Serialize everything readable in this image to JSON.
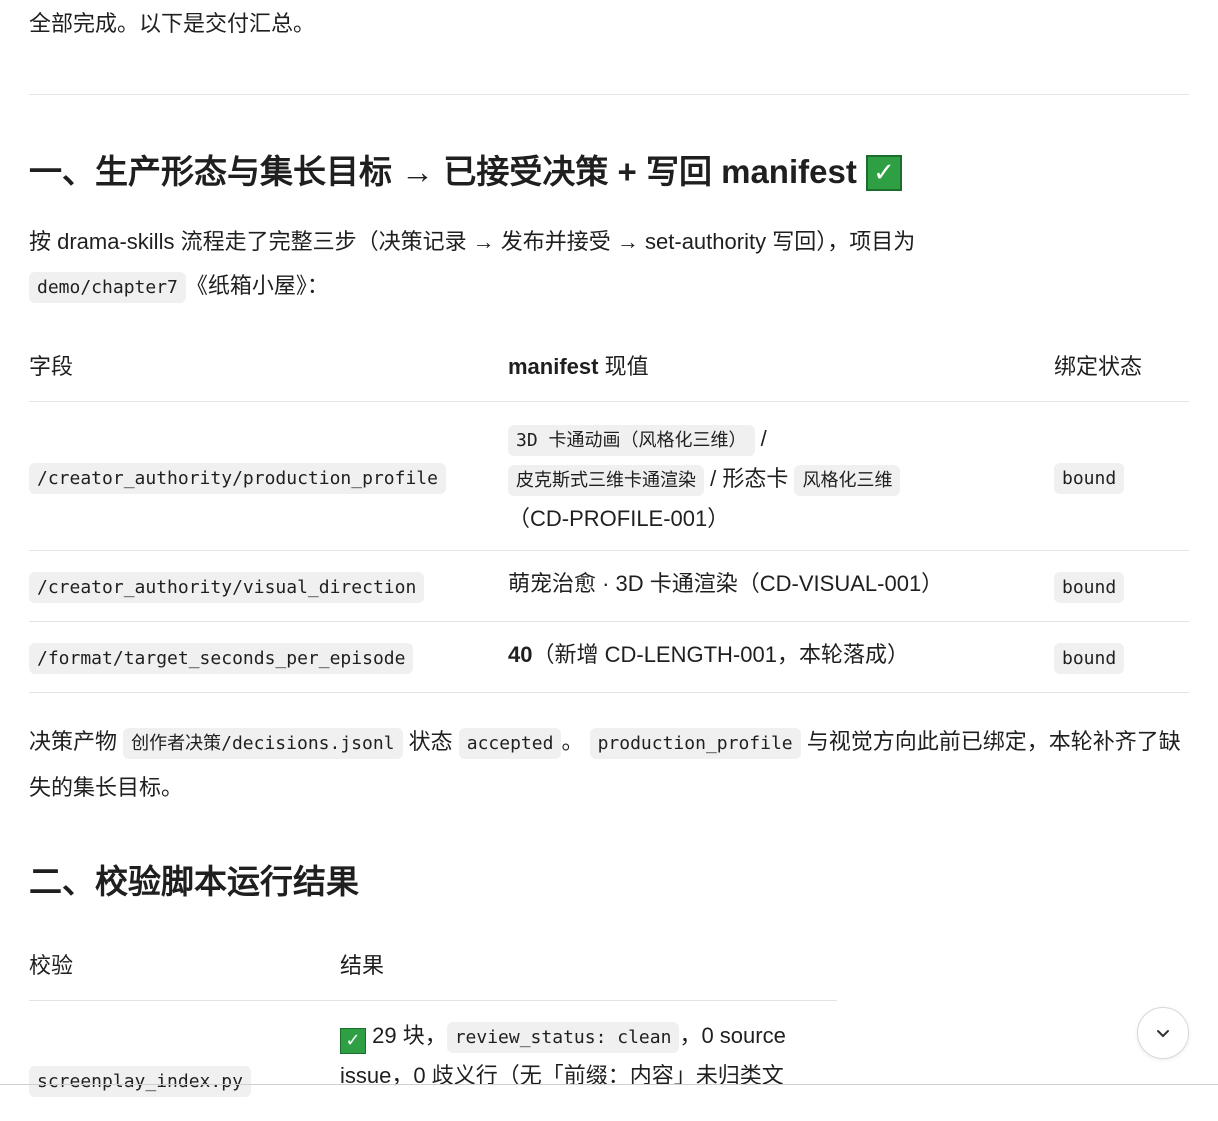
{
  "intro": "全部完成。以下是交付汇总。",
  "section1": {
    "title": "一、生产形态与集长目标 → 已接受决策 + 写回 manifest",
    "para_a": "按 drama-skills 流程走了完整三步（决策记录 → 发布并接受 → set-authority 写回），项目为",
    "para_code": "demo/chapter7",
    "para_b": "《纸箱小屋》：",
    "table": {
      "headers": [
        "字段",
        "manifest 现值",
        "绑定状态"
      ],
      "rows": [
        {
          "field": "/creator_authority/production_profile",
          "v_code1": "3D 卡通动画（风格化三维）",
          "v_sep1": " /",
          "v_code2": "皮克斯式三维卡通渲染",
          "v_mid": " / 形态卡 ",
          "v_code3": "风格化三维",
          "v_tail": "（CD-PROFILE-001）",
          "status": "bound"
        },
        {
          "field": "/creator_authority/visual_direction",
          "value": "萌宠治愈 · 3D 卡通渲染（CD-VISUAL-001）",
          "status": "bound"
        },
        {
          "field": "/format/target_seconds_per_episode",
          "value_bold": "40",
          "value": "（新增 CD-LENGTH-001，本轮落成）",
          "status": "bound"
        }
      ]
    },
    "note": {
      "t1": "决策产物 ",
      "c1": "创作者决策/decisions.jsonl",
      "t2": " 状态 ",
      "c2": "accepted",
      "t3": "。 ",
      "c3": "production_profile",
      "t4": " 与视觉方向此前已绑定，本轮补齐了缺失的集长目标。"
    }
  },
  "section2": {
    "title": "二、校验脚本运行结果",
    "table": {
      "headers": [
        "校验",
        "结果"
      ],
      "rows": [
        {
          "check": "screenplay_index.py",
          "r1": " 29 块，",
          "rc": "review_status: clean",
          "r2": "，0 source",
          "r3": "issue，0 歧义行（无「前缀：内容」未归类文"
        }
      ]
    }
  },
  "icons": {
    "check": "check-mark-icon",
    "scroll": "chevron-down-icon"
  }
}
